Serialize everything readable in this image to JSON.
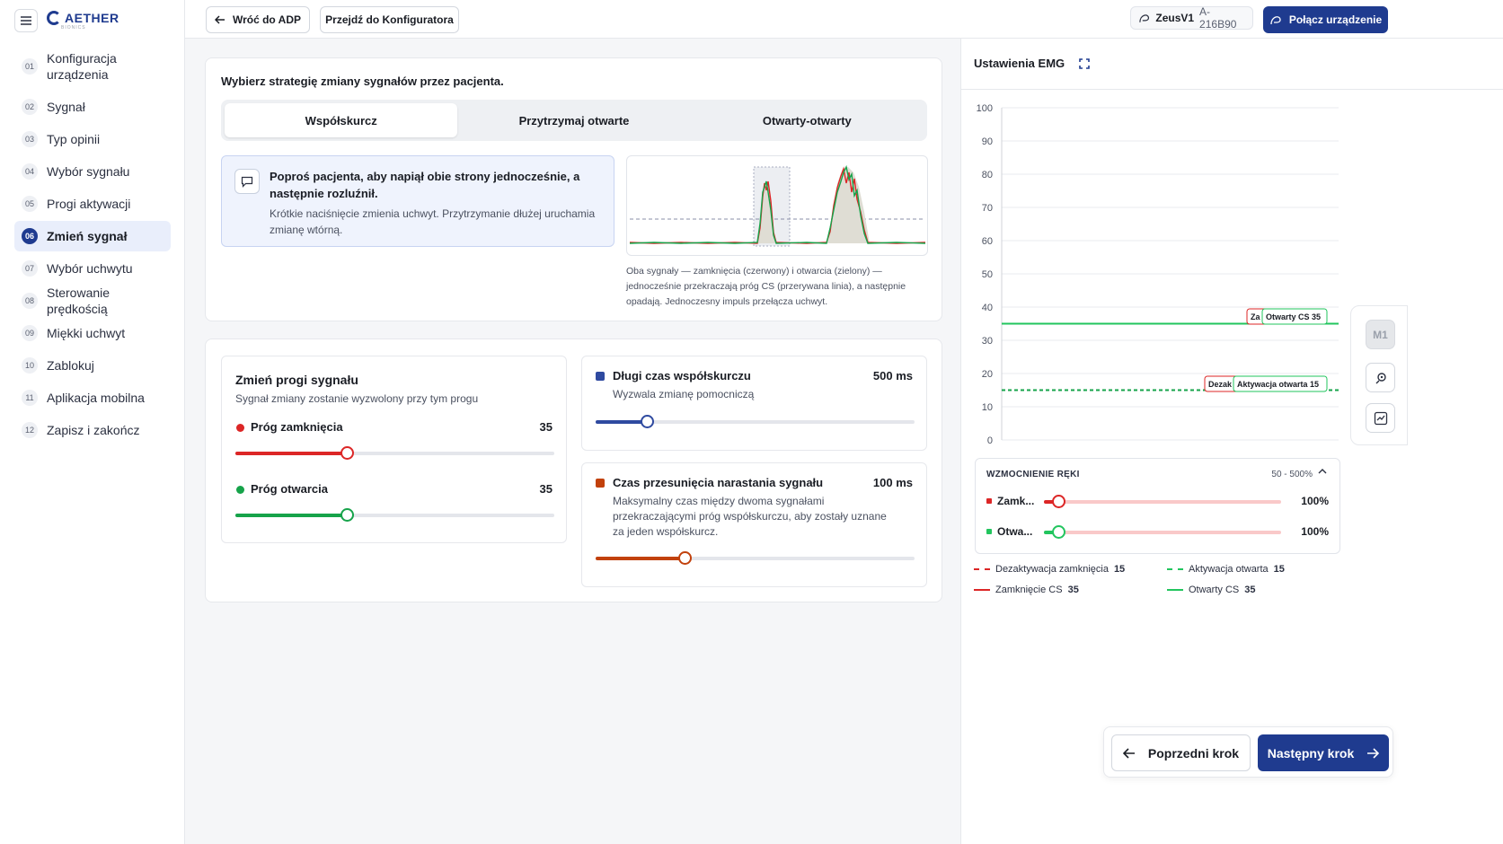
{
  "app": {
    "logo_text": "AETHER",
    "logo_sub": "BIONICS"
  },
  "sidebar": {
    "items": [
      {
        "num": "01",
        "label": "Konfiguracja urządzenia"
      },
      {
        "num": "02",
        "label": "Sygnał"
      },
      {
        "num": "03",
        "label": "Typ opinii"
      },
      {
        "num": "04",
        "label": "Wybór sygnału"
      },
      {
        "num": "05",
        "label": "Progi aktywacji"
      },
      {
        "num": "06",
        "label": "Zmień sygnał"
      },
      {
        "num": "07",
        "label": "Wybór uchwytu"
      },
      {
        "num": "08",
        "label": "Sterowanie prędkością"
      },
      {
        "num": "09",
        "label": "Miękki uchwyt"
      },
      {
        "num": "10",
        "label": "Zablokuj"
      },
      {
        "num": "11",
        "label": "Aplikacja mobilna"
      },
      {
        "num": "12",
        "label": "Zapisz i zakończ"
      }
    ],
    "active_index": 5
  },
  "topbar": {
    "back_label": "Wróć do ADP",
    "configurator_label": "Przejdź do Konfiguratora",
    "device_name": "ZeusV1",
    "device_id": "A-216B90",
    "connect_label": "Połącz urządzenie"
  },
  "strategy": {
    "title": "Wybierz strategię zmiany sygnałów przez pacjenta.",
    "tabs": [
      "Współskurcz",
      "Przytrzymaj otwarte",
      "Otwarty-otwarty"
    ],
    "active_tab": 0,
    "info_head": "Poproś pacjenta, aby napiął obie strony jednocześnie, a następnie rozluźnił.",
    "info_sub": "Krótkie naciśnięcie zmienia uchwyt. Przytrzymanie dłużej uruchamia zmianę wtórną.",
    "caption": "Oba sygnały — zamknięcia (czerwony) i otwarcia (zielony) — jednocześnie przekraczają próg CS (przerywana linia), a następnie opadają. Jednoczesny impuls przełącza uchwyt."
  },
  "thresholds": {
    "title": "Zmień progi sygnału",
    "subtitle": "Sygnał zmiany zostanie wyzwolony przy tym progu",
    "close_label": "Próg zamknięcia",
    "close_value": "35",
    "close_fraction": 0.35,
    "open_label": "Próg otwarcia",
    "open_value": "35",
    "open_fraction": 0.35,
    "close_color": "#dc2626",
    "open_color": "#16a34a"
  },
  "long_cocontraction": {
    "title": "Długi czas współskurczu",
    "value": "500 ms",
    "subtitle": "Wyzwala zmianę pomocniczą",
    "fraction": 0.16,
    "color": "#2f4aa0"
  },
  "rise_offset": {
    "title": "Czas przesunięcia narastania sygnału",
    "value": "100 ms",
    "subtitle": "Maksymalny czas między dwoma sygnałami przekraczającymi próg współskurczu, aby zostały uznane za jeden współskurcz.",
    "fraction": 0.28,
    "color": "#c2410c"
  },
  "emg": {
    "title": "Ustawienia EMG",
    "y_ticks": [
      "100",
      "90",
      "80",
      "70",
      "60",
      "50",
      "40",
      "30",
      "20",
      "10",
      "0"
    ],
    "tag_zam_cs": "Za",
    "tag_open_cs": "Otwarty CS 35",
    "tag_deakt": "Dezak",
    "tag_akt": "Aktywacja otwarta 15",
    "gain": {
      "title": "WZMOCNIENIE RĘKI",
      "range": "50 - 500%",
      "rows": [
        {
          "label": "Zamk...",
          "value": "100%",
          "color": "#dc2626",
          "fraction": 0.06
        },
        {
          "label": "Otwa...",
          "value": "100%",
          "color": "#22c55e",
          "fraction": 0.06
        }
      ]
    },
    "legend": [
      {
        "label": "Dezaktywacja zamknięcia",
        "value": "15",
        "color": "#dc2626",
        "dashed": true
      },
      {
        "label": "Aktywacja otwarta",
        "value": "15",
        "color": "#22c55e",
        "dashed": true
      },
      {
        "label": "Zamknięcie CS",
        "value": "35",
        "color": "#dc2626",
        "dashed": false
      },
      {
        "label": "Otwarty CS",
        "value": "35",
        "color": "#22c55e",
        "dashed": false
      }
    ],
    "lines": {
      "cs": 35,
      "activation": 15
    }
  },
  "tools": {
    "m1_label": "M1"
  },
  "footer": {
    "prev_label": "Poprzedni krok",
    "next_label": "Następny krok"
  },
  "colors": {
    "primary": "#1f3b8f",
    "red": "#dc2626",
    "green": "#22c55e"
  }
}
